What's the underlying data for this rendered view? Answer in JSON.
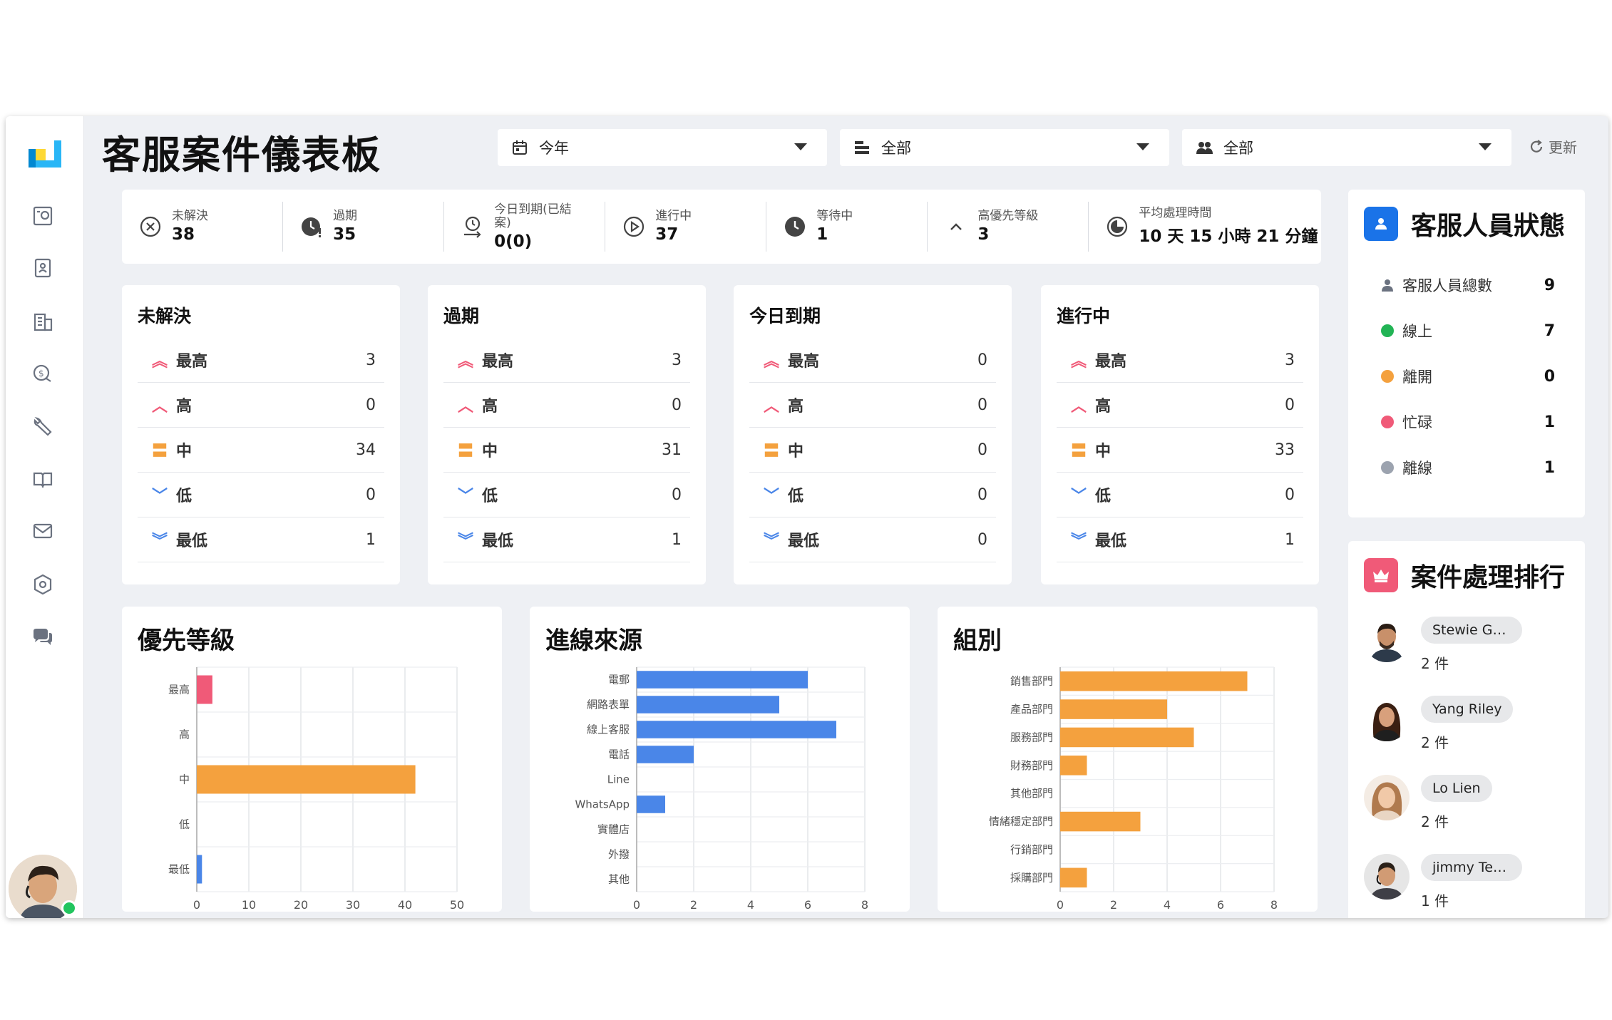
{
  "page": {
    "title": "客服案件儀表板"
  },
  "filters": [
    {
      "icon": "calendar-icon",
      "value": "今年"
    },
    {
      "icon": "list-icon",
      "value": "全部"
    },
    {
      "icon": "users-icon",
      "value": "全部"
    }
  ],
  "refresh_label": "更新",
  "summary": [
    {
      "icon": "close-circle-icon",
      "label": "未解決",
      "value": "38"
    },
    {
      "icon": "clock-overdue-icon",
      "label": "過期",
      "value": "35"
    },
    {
      "icon": "timer-icon",
      "label": "今日到期(已結案)",
      "value": "0(0)"
    },
    {
      "icon": "play-circle-icon",
      "label": "進行中",
      "value": "37"
    },
    {
      "icon": "clock-icon",
      "label": "等待中",
      "value": "1"
    },
    {
      "icon": "chevron-up-icon",
      "label": "高優先等級",
      "value": "3"
    },
    {
      "icon": "gauge-icon",
      "label": "平均處理時間",
      "value": "10 天 15 小時 21 分鐘"
    }
  ],
  "priority_labels": [
    "最高",
    "高",
    "中",
    "低",
    "最低"
  ],
  "priority_cards": [
    {
      "title": "未解決",
      "values": [
        "3",
        "0",
        "34",
        "0",
        "1"
      ]
    },
    {
      "title": "過期",
      "values": [
        "3",
        "0",
        "31",
        "0",
        "1"
      ]
    },
    {
      "title": "今日到期",
      "values": [
        "0",
        "0",
        "0",
        "0",
        "0"
      ]
    },
    {
      "title": "進行中",
      "values": [
        "3",
        "0",
        "33",
        "0",
        "1"
      ]
    }
  ],
  "chart_data": [
    {
      "type": "bar",
      "orientation": "horizontal",
      "title": "優先等級",
      "categories": [
        "最高",
        "高",
        "中",
        "低",
        "最低"
      ],
      "values": [
        3,
        0,
        42,
        0,
        1
      ],
      "bar_colors": [
        "#f05a78",
        "#f05a78",
        "#f4a13e",
        "#4a86e8",
        "#4a86e8"
      ],
      "xlim": [
        0,
        50
      ],
      "xticks": [
        0,
        10,
        20,
        30,
        40,
        50
      ],
      "grid": true
    },
    {
      "type": "bar",
      "orientation": "horizontal",
      "title": "進線來源",
      "categories": [
        "電郵",
        "網路表單",
        "線上客服",
        "電話",
        "Line",
        "WhatsApp",
        "實體店",
        "外撥",
        "其他"
      ],
      "values": [
        6,
        5,
        7,
        2,
        0,
        1,
        0,
        0,
        0
      ],
      "color": "#4a86e8",
      "xlim": [
        0,
        8
      ],
      "xticks": [
        0,
        2,
        4,
        6,
        8
      ],
      "grid": true
    },
    {
      "type": "bar",
      "orientation": "horizontal",
      "title": "組別",
      "categories": [
        "銷售部門",
        "產品部門",
        "服務部門",
        "財務部門",
        "其他部門",
        "情緒穩定部門",
        "行銷部門",
        "採購部門"
      ],
      "values": [
        7,
        4,
        5,
        1,
        0,
        3,
        0,
        1
      ],
      "color": "#f4a13e",
      "xlim": [
        0,
        8
      ],
      "xticks": [
        0,
        2,
        4,
        6,
        8
      ],
      "grid": true
    }
  ],
  "agent_status": {
    "title": "客服人員狀態",
    "rows": [
      {
        "label": "客服人員總數",
        "count": "9",
        "color": "#6b7280",
        "icon": "person-icon"
      },
      {
        "label": "線上",
        "count": "7",
        "color": "#22b455"
      },
      {
        "label": "離開",
        "count": "0",
        "color": "#f4a13e"
      },
      {
        "label": "忙碌",
        "count": "1",
        "color": "#f05a78"
      },
      {
        "label": "離線",
        "count": "1",
        "color": "#9ca3af"
      }
    ]
  },
  "ranking": {
    "title": "案件處理排行",
    "items": [
      {
        "name": "Stewie Gri…",
        "count": "2 件"
      },
      {
        "name": "Yang Riley",
        "count": "2 件"
      },
      {
        "name": "Lo Lien",
        "count": "2 件"
      },
      {
        "name": "jimmy Tester",
        "count": "1 件"
      }
    ]
  },
  "colors": {
    "accent_blue": "#1a73e8",
    "pink": "#f05a78",
    "orange": "#f4a13e",
    "blue_bar": "#4a86e8"
  }
}
